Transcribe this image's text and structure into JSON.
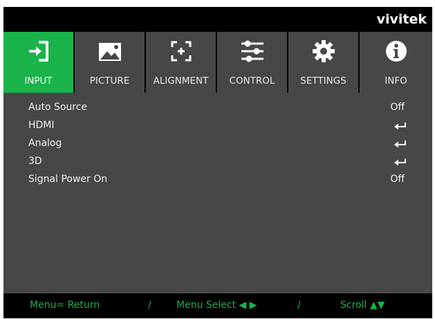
{
  "header": {
    "brand": "vivitek"
  },
  "tabs": [
    {
      "label": "INPUT",
      "icon": "input-icon",
      "active": true
    },
    {
      "label": "PICTURE",
      "icon": "picture-icon",
      "active": false
    },
    {
      "label": "ALIGNMENT",
      "icon": "alignment-icon",
      "active": false
    },
    {
      "label": "CONTROL",
      "icon": "control-sliders-icon",
      "active": false
    },
    {
      "label": "SETTINGS",
      "icon": "gear-icon",
      "active": false
    },
    {
      "label": "INFO",
      "icon": "info-icon",
      "active": false
    }
  ],
  "menu": {
    "items": [
      {
        "label": "Auto Source",
        "value": "Off"
      },
      {
        "label": "HDMI",
        "value_icon": "enter-icon"
      },
      {
        "label": "Analog",
        "value_icon": "enter-icon"
      },
      {
        "label": "3D",
        "value_icon": "enter-icon"
      },
      {
        "label": "Signal Power On",
        "value": "Off"
      }
    ]
  },
  "footer": {
    "return_hint": "Menu= Return",
    "separator": "/",
    "select_hint": "Menu Select ◀ ▶",
    "scroll_hint": "Scroll ▲▼"
  },
  "colors": {
    "accent": "#19b34a",
    "tab_bg": "#474747",
    "panel_bg": "#474747",
    "frame": "#000000"
  }
}
